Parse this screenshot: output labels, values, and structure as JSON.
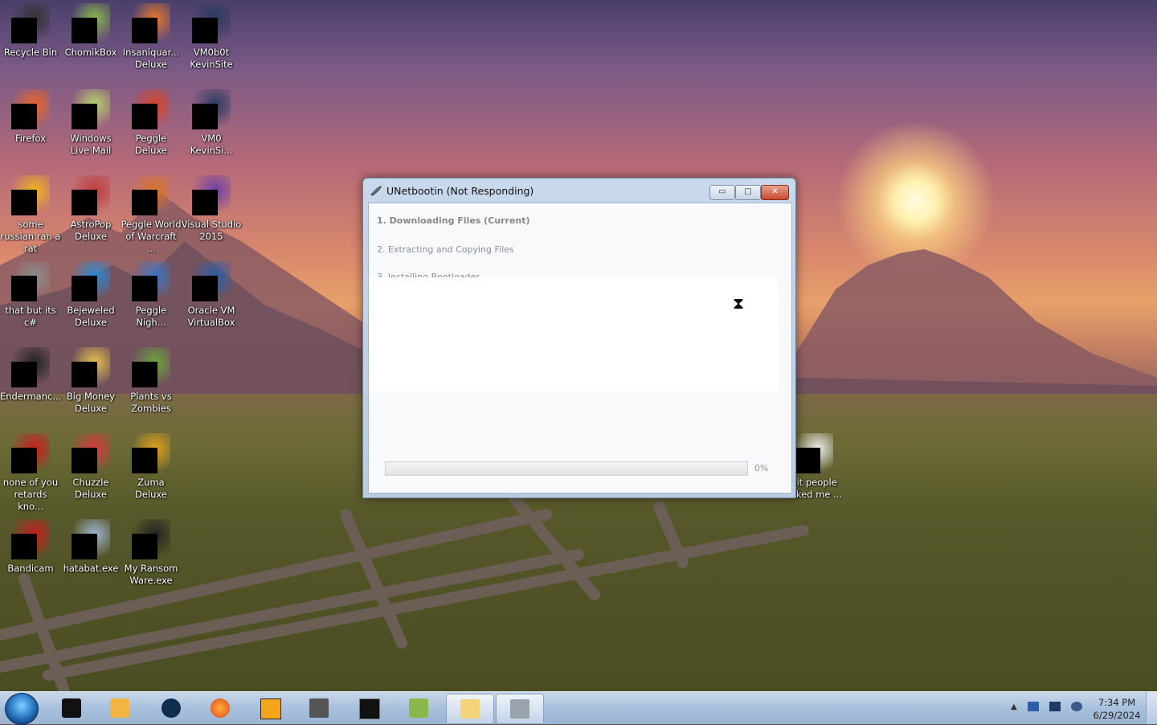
{
  "window": {
    "title": "UNetbootin (Not Responding)",
    "steps": [
      "1. Downloading Files (Current)",
      "2. Extracting and Copying Files",
      "3. Installing Bootloader"
    ],
    "progress_text": "0%",
    "progress_value": 0,
    "minimize_label": "▭",
    "maximize_label": "□",
    "close_label": "✕"
  },
  "desktop_icons": [
    {
      "label": "Recycle Bin",
      "icon": "recycle-bin-icon"
    },
    {
      "label": "ChomikBox",
      "icon": "chomikbox-icon"
    },
    {
      "label": "Insaniquar... Deluxe",
      "icon": "insaniquarium-icon"
    },
    {
      "label": "VM0b0t KevinSite",
      "icon": "vm-shortcut-icon"
    },
    {
      "label": "Firefox",
      "icon": "firefox-icon"
    },
    {
      "label": "Windows Live Mail",
      "icon": "mail-icon"
    },
    {
      "label": "Peggle Deluxe",
      "icon": "peggle-icon"
    },
    {
      "label": "VM0 KevinSi...",
      "icon": "vm-shortcut-icon"
    },
    {
      "label": "some russian ran a rat",
      "icon": "folder-icon"
    },
    {
      "label": "AstroPop Deluxe",
      "icon": "astropop-icon"
    },
    {
      "label": "Peggle World of Warcraft ...",
      "icon": "peggle-wow-icon"
    },
    {
      "label": "Visual Studio 2015",
      "icon": "visual-studio-icon"
    },
    {
      "label": "that but its c#",
      "icon": "window-stack-icon"
    },
    {
      "label": "Bejeweled Deluxe",
      "icon": "bejeweled-icon"
    },
    {
      "label": "Peggle Nigh...",
      "icon": "peggle-nights-icon"
    },
    {
      "label": "Oracle VM VirtualBox",
      "icon": "virtualbox-icon"
    },
    {
      "label": "Endermanc...",
      "icon": "console-icon"
    },
    {
      "label": "Big Money Deluxe",
      "icon": "big-money-icon"
    },
    {
      "label": "Plants vs Zombies",
      "icon": "pvz-icon"
    },
    {
      "label": "none of you retards kno...",
      "icon": "red-circle-icon"
    },
    {
      "label": "Chuzzle Deluxe",
      "icon": "chuzzle-icon"
    },
    {
      "label": "Zuma Deluxe",
      "icon": "zuma-icon"
    },
    {
      "label": "nit people asked me ...",
      "icon": "document-icon"
    },
    {
      "label": "Bandicam",
      "icon": "bandicam-icon"
    },
    {
      "label": "hatabat.exe",
      "icon": "hatabat-icon"
    },
    {
      "label": "My Ransom Ware.exe",
      "icon": "console-icon"
    }
  ],
  "taskbar": {
    "clock_time": "7:34 PM",
    "clock_date": "6/29/2024",
    "tray_arrow": "▲",
    "apps": [
      "start-orb-icon",
      "black-box-icon",
      "media-player-icon",
      "globe-icon",
      "firefox-icon",
      "de-app-icon",
      "window-stack-icon",
      "console-icon",
      "chomikbox-icon",
      "explorer-icon",
      "unetbootin-icon"
    ]
  },
  "colors": {
    "taskbar_bg": "#a9c0dc",
    "window_frame": "#b7cbe3",
    "close_button": "#c94a2f"
  }
}
